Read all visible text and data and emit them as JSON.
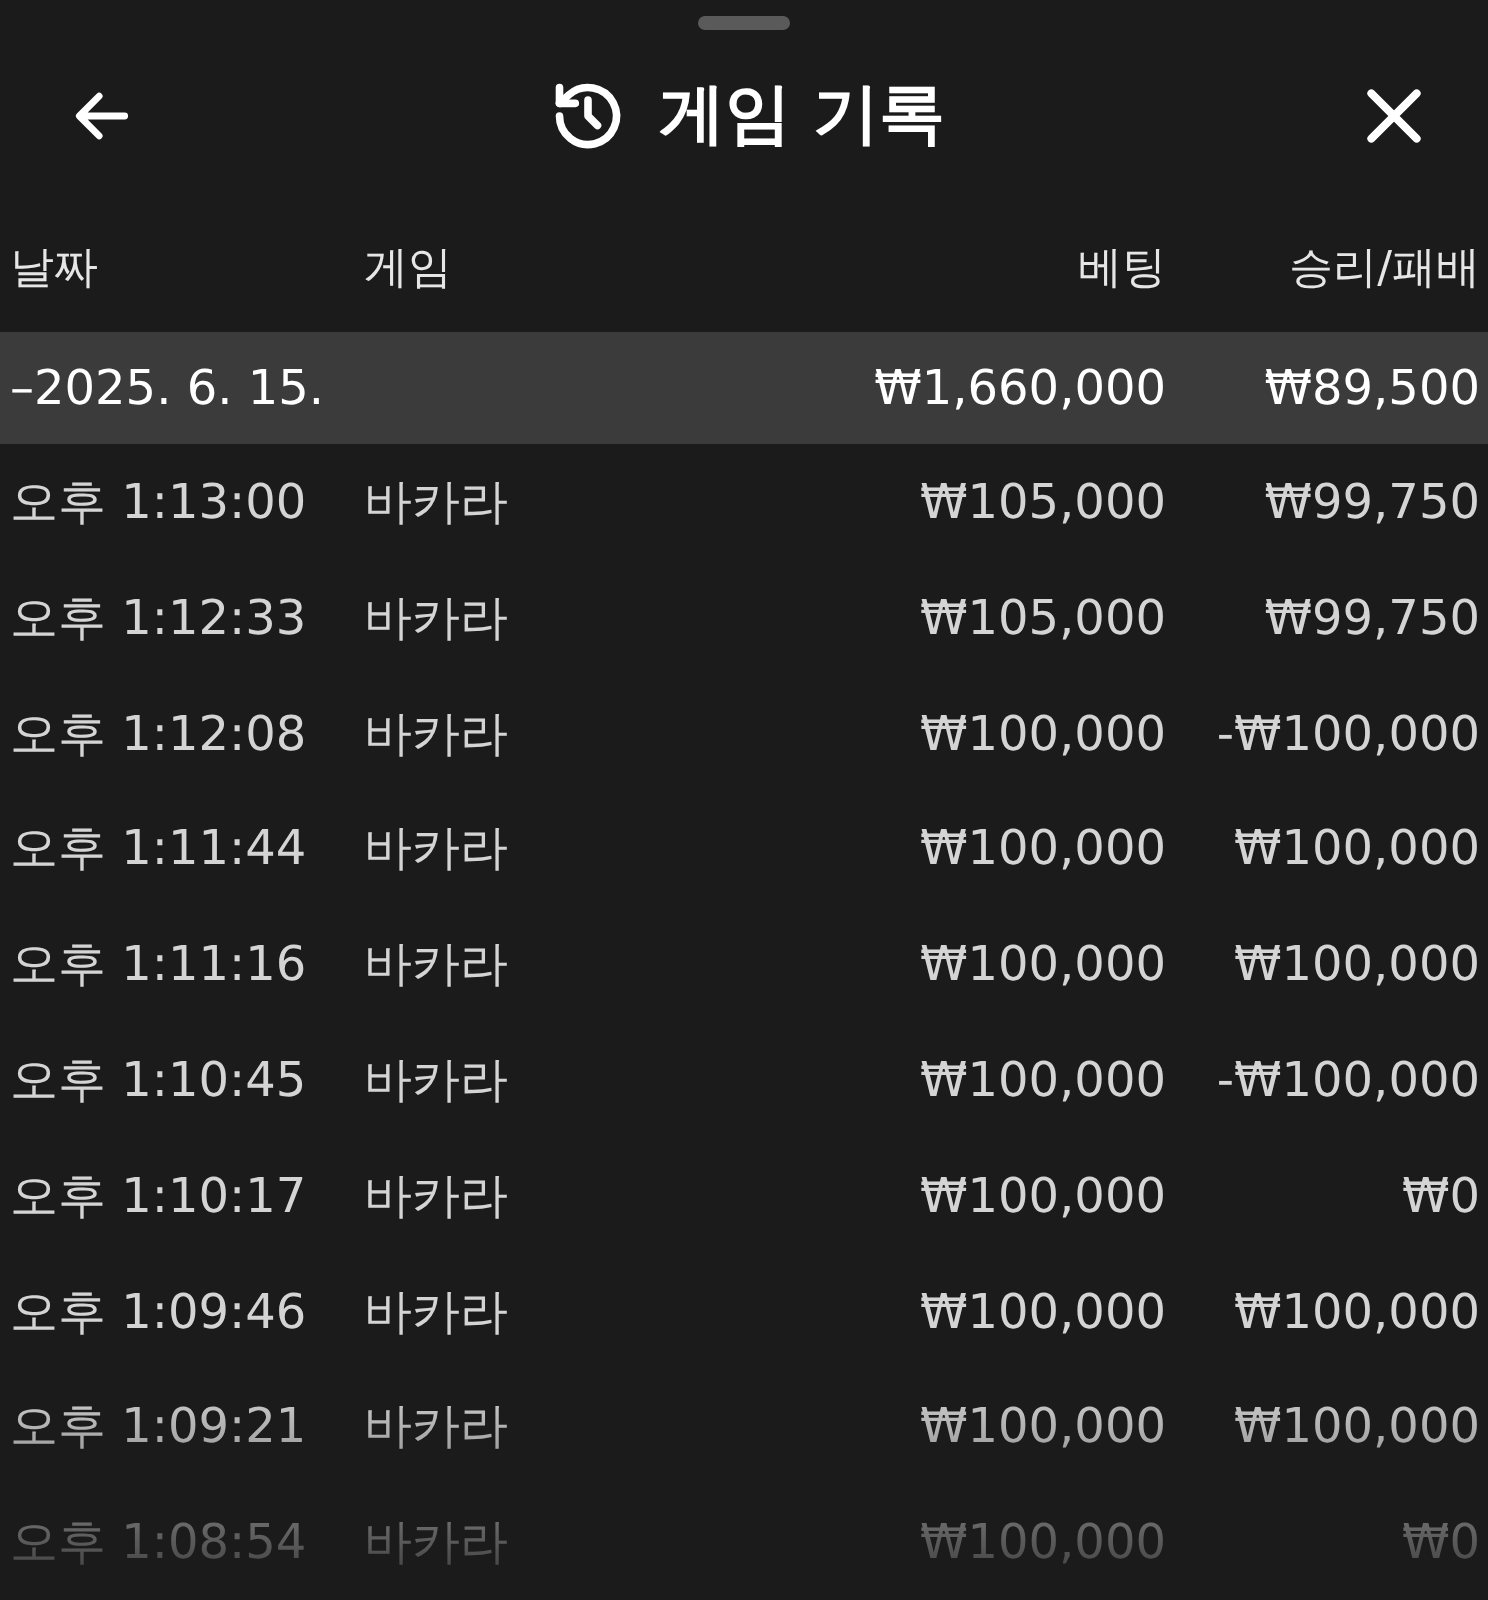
{
  "header": {
    "title": "게임 기록"
  },
  "table": {
    "columns": [
      "날짜",
      "게임",
      "베팅",
      "승리/패배"
    ],
    "summary": {
      "date": "–2025. 6. 15.",
      "bet": "₩1,660,000",
      "result": "₩89,500"
    },
    "rows": [
      {
        "time": "오후 1:13:00",
        "game": "바카라",
        "bet": "₩105,000",
        "result": "₩99,750"
      },
      {
        "time": "오후 1:12:33",
        "game": "바카라",
        "bet": "₩105,000",
        "result": "₩99,750"
      },
      {
        "time": "오후 1:12:08",
        "game": "바카라",
        "bet": "₩100,000",
        "result": "-₩100,000"
      },
      {
        "time": "오후 1:11:44",
        "game": "바카라",
        "bet": "₩100,000",
        "result": "₩100,000"
      },
      {
        "time": "오후 1:11:16",
        "game": "바카라",
        "bet": "₩100,000",
        "result": "₩100,000"
      },
      {
        "time": "오후 1:10:45",
        "game": "바카라",
        "bet": "₩100,000",
        "result": "-₩100,000"
      },
      {
        "time": "오후 1:10:17",
        "game": "바카라",
        "bet": "₩100,000",
        "result": "₩0"
      },
      {
        "time": "오후 1:09:46",
        "game": "바카라",
        "bet": "₩100,000",
        "result": "₩100,000"
      },
      {
        "time": "오후 1:09:21",
        "game": "바카라",
        "bet": "₩100,000",
        "result": "₩100,000"
      },
      {
        "time": "오후 1:08:54",
        "game": "바카라",
        "bet": "₩100,000",
        "result": "₩0"
      }
    ]
  }
}
